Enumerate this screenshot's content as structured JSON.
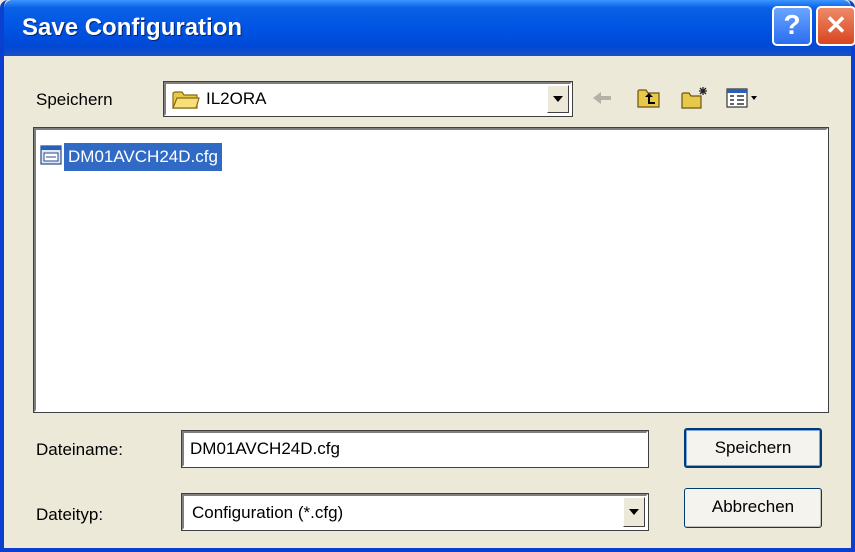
{
  "window": {
    "title": "Save Configuration"
  },
  "titlebar": {
    "help_label": "?",
    "close_label": "✕"
  },
  "location": {
    "label": "Speichern",
    "folder": "IL2ORA"
  },
  "toolbar": {
    "back_icon": "back-arrow-icon",
    "up_icon": "up-folder-icon",
    "new_icon": "new-folder-icon",
    "view_icon": "view-menu-icon"
  },
  "files": [
    {
      "name": "DM01AVCH24D.cfg",
      "icon": "cfg-file-icon",
      "selected": true
    }
  ],
  "filename": {
    "label": "Dateiname:",
    "value": "DM01AVCH24D.cfg"
  },
  "filetype": {
    "label": "Dateityp:",
    "value": "Configuration (*.cfg)"
  },
  "buttons": {
    "save": "Speichern",
    "cancel": "Abbrechen"
  },
  "colors": {
    "selection": "#316ac5",
    "titlebar": "#0054e3",
    "dialog_bg": "#ece9d8"
  }
}
